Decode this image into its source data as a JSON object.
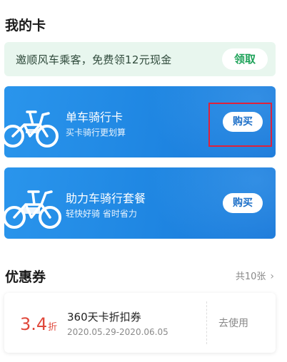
{
  "sections": {
    "my_cards": "我的卡",
    "coupons": "优惠券"
  },
  "promo": {
    "text": "邀顺风车乘客，免费领12元现金",
    "button": "领取"
  },
  "cards": [
    {
      "title": "单车骑行卡",
      "subtitle": "买卡骑行更划算",
      "button": "购买"
    },
    {
      "title": "助力车骑行套餐",
      "subtitle": "轻快好骑 省时省力",
      "button": "购买"
    }
  ],
  "coupons_total": "共10张",
  "coupon": {
    "value": "3.4",
    "unit": "折",
    "name": "360天卡折扣券",
    "date_range": "2020.05.29-2020.06.05",
    "action": "去使用"
  },
  "colors": {
    "card_blue": "#1f86e2",
    "promo_bg": "#e8f6ee",
    "promo_green": "#1fa35a",
    "coupon_red": "#e0483b",
    "highlight_red": "#e0213a"
  },
  "icons": {
    "bike": "bicycle-icon",
    "ebike": "ebike-icon",
    "chevron": "chevron-right-icon"
  }
}
